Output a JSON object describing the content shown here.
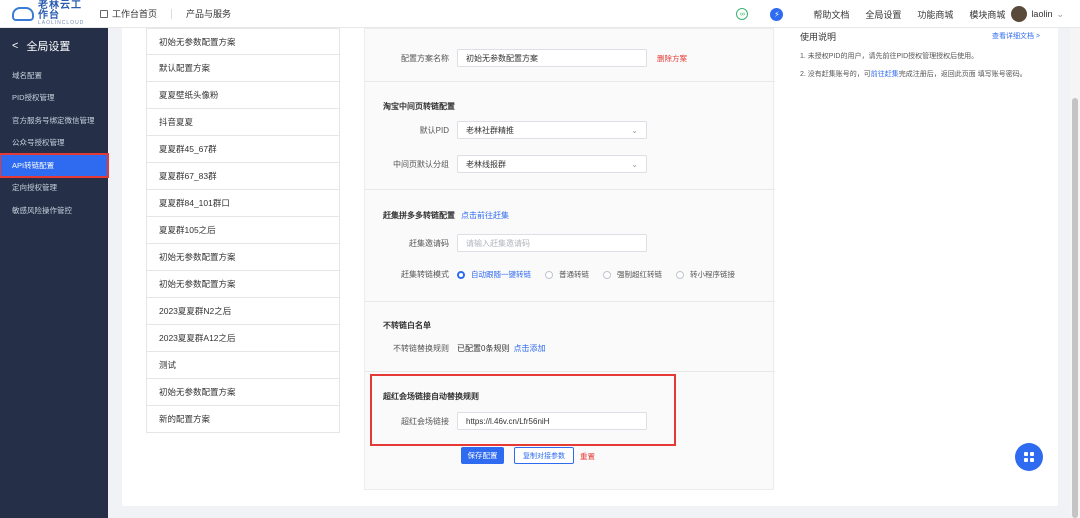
{
  "header": {
    "logo_cn": "老林云工作台",
    "logo_en": "LAOLINCLOUD",
    "home_label": "工作台首页",
    "products_label": "产品与服务",
    "links": [
      "帮助文档",
      "全局设置",
      "功能商城",
      "模块商城"
    ],
    "username": "laolin"
  },
  "sidebar": {
    "title": "全局设置",
    "items": [
      "域名配置",
      "PID授权管理",
      "官方服务号绑定微信管理",
      "公众号授权管理",
      "API转链配置",
      "定向授权管理",
      "敏感风险操作管控"
    ],
    "active_index": 4
  },
  "plans": [
    "初始无参数配置方案",
    "默认配置方案",
    "夏夏壁纸头像粉",
    "抖音夏夏",
    "夏夏群45_67群",
    "夏夏群67_83群",
    "夏夏群84_101群口",
    "夏夏群105之后",
    "初始无参数配置方案",
    "初始无参数配置方案",
    "2023夏夏群N2之后",
    "2023夏夏群A12之后",
    "测试",
    "初始无参数配置方案",
    "新的配置方案"
  ],
  "form": {
    "plan_name_label": "配置方案名称",
    "plan_name_value": "初始无参数配置方案",
    "delete_label": "删除方案",
    "taobao_section": "淘宝中间页转链配置",
    "default_pid_label": "默认PID",
    "default_pid_value": "老林社群精推",
    "group_label": "中间页默认分组",
    "group_value": "老林线报群",
    "pdd_section": "赶集拼多多转链配置",
    "pdd_link": "点击前往赶集",
    "invite_label": "赶集邀请码",
    "invite_placeholder": "请输入赶集邀请码",
    "mode_label": "赶集转链模式",
    "modes": [
      "自动跟随一键转链",
      "普通转链",
      "强制超红转链",
      "转小程序链接"
    ],
    "whitelist_section": "不转链白名单",
    "whitelist_label": "不转链替换规则",
    "whitelist_value": "已配置0条规则",
    "whitelist_add": "点击添加",
    "red_section": "超红会场链接自动替换规则",
    "red_label": "超红会场链接",
    "red_value": "https://l.46v.cn/Lfr56niH"
  },
  "actions": {
    "save": "保存配置",
    "copy": "复制对接参数",
    "reset": "重置"
  },
  "help": {
    "title": "使用说明",
    "more": "查看详细文档 >",
    "line1": "1. 未授权PID的用户，请先前往PID授权管理授权后使用。",
    "line2_pre": "2. 没有赶集账号的，可",
    "line2_link": "前往赶集",
    "line2_post": "完成注册后，返回此页面 填写账号密码。"
  },
  "colors": {
    "accent": "#2f6bf0",
    "sidebar_bg": "#253048",
    "danger": "#e53935"
  }
}
